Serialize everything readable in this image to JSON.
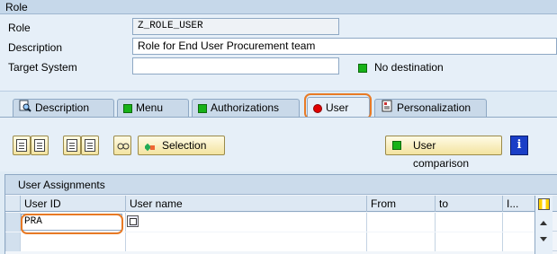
{
  "header": {
    "title": "Role"
  },
  "form": {
    "role_label": "Role",
    "role_value": "Z_ROLE_USER",
    "description_label": "Description",
    "description_value": "Role for End User Procurement team",
    "target_label": "Target System",
    "target_value": "",
    "destination_status": "No destination"
  },
  "tabs": [
    {
      "label": "Description",
      "icon": "doc-search-icon"
    },
    {
      "label": "Menu",
      "icon": "green-square-icon"
    },
    {
      "label": "Authorizations",
      "icon": "green-square-icon"
    },
    {
      "label": "User",
      "icon": "red-dot-icon",
      "active": true
    },
    {
      "label": "Personalization",
      "icon": "personalization-icon"
    }
  ],
  "toolbar": {
    "selection_label": "Selection",
    "user_comparison_label": "User comparison",
    "info_label": "i"
  },
  "table": {
    "title": "User Assignments",
    "columns": [
      "User ID",
      "User name",
      "From",
      "to",
      "I..."
    ],
    "rows": [
      {
        "user_id": "PRA",
        "user_name": "",
        "from": "",
        "to": ""
      }
    ]
  },
  "colors": {
    "accent_highlight": "#e87a25",
    "status_green": "#18b218",
    "status_red": "#e00000"
  }
}
